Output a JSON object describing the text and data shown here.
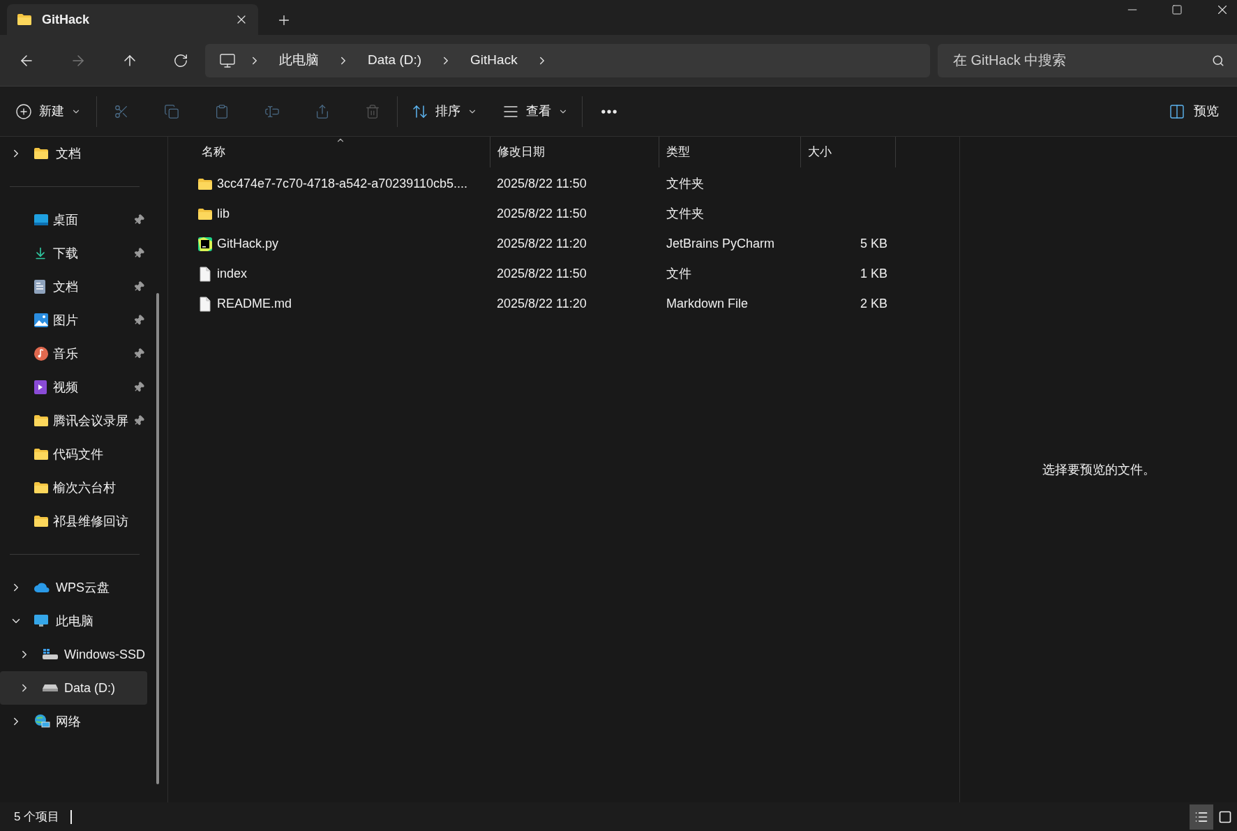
{
  "tab": {
    "title": "GitHack",
    "selected": true
  },
  "nav": {
    "back_disabled": false,
    "forward_disabled": true
  },
  "breadcrumbs": [
    "此电脑",
    "Data (D:)",
    "GitHack"
  ],
  "search": {
    "placeholder": "在 GitHack 中搜索"
  },
  "toolbar": {
    "new": {
      "label": "新建"
    },
    "actions": [
      {
        "kind": "cut",
        "disabled": true
      },
      {
        "kind": "copy",
        "disabled": true
      },
      {
        "kind": "paste",
        "disabled": true
      },
      {
        "kind": "rename",
        "disabled": true
      },
      {
        "kind": "share",
        "disabled": true
      },
      {
        "kind": "delete",
        "disabled": true
      }
    ],
    "sort": {
      "label": "排序"
    },
    "view": {
      "label": "查看"
    },
    "preview": {
      "label": "预览",
      "selected": false
    }
  },
  "sidebar": {
    "sections": [
      {
        "items": [
          {
            "label": "文档",
            "kind": "folder",
            "expanded": false,
            "selected": false
          }
        ]
      },
      {
        "items": [
          {
            "label": "桌面",
            "kind": "desktop",
            "pinned": true,
            "selected": false
          },
          {
            "label": "下载",
            "kind": "download",
            "pinned": true,
            "selected": false
          },
          {
            "label": "文档",
            "kind": "documents",
            "pinned": true,
            "selected": false
          },
          {
            "label": "图片",
            "kind": "pictures",
            "pinned": true,
            "selected": false
          },
          {
            "label": "音乐",
            "kind": "music",
            "pinned": true,
            "selected": false
          },
          {
            "label": "视频",
            "kind": "videos",
            "pinned": true,
            "selected": false
          },
          {
            "label": "腾讯会议录屏",
            "kind": "folder",
            "pinned": true,
            "selected": false
          },
          {
            "label": "代码文件",
            "kind": "folder",
            "pinned": false,
            "selected": false
          },
          {
            "label": "榆次六台村",
            "kind": "folder",
            "pinned": false,
            "selected": false
          },
          {
            "label": "祁县维修回访",
            "kind": "folder",
            "pinned": false,
            "selected": false
          }
        ]
      },
      {
        "items": [
          {
            "label": "WPS云盘",
            "kind": "cloud",
            "expanded": false,
            "selected": false
          },
          {
            "label": "此电脑",
            "kind": "pc",
            "expanded": true,
            "selected": false,
            "children": [
              {
                "label": "Windows-SSD",
                "kind": "ssd",
                "expanded": false,
                "selected": false
              },
              {
                "label": "Data (D:)",
                "kind": "drive",
                "expanded": false,
                "selected": true
              }
            ]
          },
          {
            "label": "网络",
            "kind": "network",
            "expanded": false,
            "selected": false
          }
        ]
      }
    ]
  },
  "table": {
    "columns": [
      {
        "label": "名称",
        "sorted": true
      },
      {
        "label": "修改日期",
        "sorted": false
      },
      {
        "label": "类型",
        "sorted": false
      },
      {
        "label": "大小",
        "sorted": false
      }
    ],
    "rows": [
      {
        "kind": "folder",
        "name": "3cc474e7-7c70-4718-a542-a70239110cb5....",
        "modified": "2025/8/22 11:50",
        "type": "文件夹"
      },
      {
        "kind": "folder",
        "name": "lib",
        "modified": "2025/8/22 11:50",
        "type": "文件夹"
      },
      {
        "kind": "pycharm",
        "name": "GitHack.py",
        "modified": "2025/8/22 11:20",
        "type": "JetBrains PyCharm",
        "size": "5 KB"
      },
      {
        "kind": "file",
        "name": "index",
        "modified": "2025/8/22 11:50",
        "type": "文件",
        "size": "1 KB"
      },
      {
        "kind": "file",
        "name": "README.md",
        "modified": "2025/8/22 11:20",
        "type": "Markdown File",
        "size": "2 KB"
      }
    ]
  },
  "preview_pane": {
    "message": "选择要预览的文件。"
  },
  "status_bar": {
    "count": "5 个项目",
    "views": [
      {
        "kind": "details",
        "selected": true
      },
      {
        "kind": "tiles",
        "selected": false
      }
    ]
  }
}
